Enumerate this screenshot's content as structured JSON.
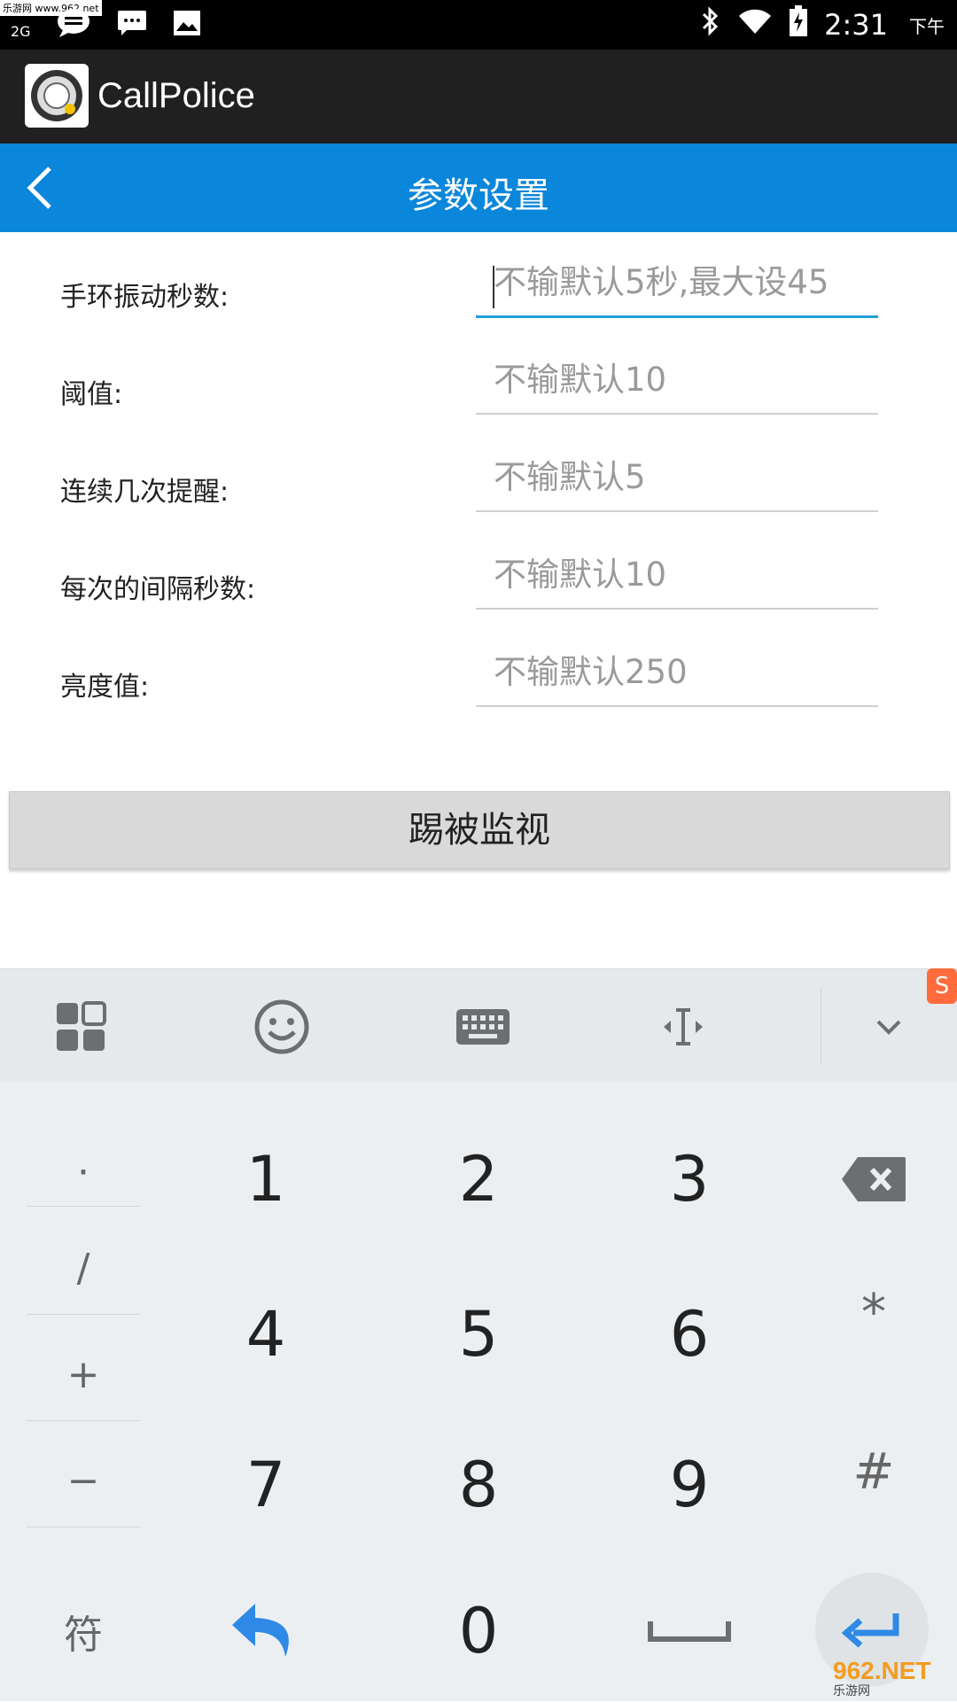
{
  "status_bar": {
    "watermark": "乐游网 www.962.net",
    "network": "2G",
    "time": "2:31",
    "ampm": "下午"
  },
  "app_bar": {
    "title": "CallPolice"
  },
  "nav": {
    "title": "参数设置"
  },
  "form": {
    "rows": [
      {
        "label": "手环振动秒数:",
        "placeholder": "不输默认5秒,最大设45"
      },
      {
        "label": "阈值:",
        "placeholder": "不输默认10"
      },
      {
        "label": "连续几次提醒:",
        "placeholder": "不输默认5"
      },
      {
        "label": "每次的间隔秒数:",
        "placeholder": "不输默认10"
      },
      {
        "label": "亮度值:",
        "placeholder": "不输默认250"
      }
    ]
  },
  "action_button": {
    "label": "踢被监视"
  },
  "keyboard": {
    "side_keys": [
      "·",
      "/",
      "+",
      "−"
    ],
    "digits": [
      "1",
      "2",
      "3",
      "4",
      "5",
      "6",
      "7",
      "8",
      "9",
      "0"
    ],
    "right_keys": [
      "*",
      "#"
    ],
    "symbol_key": "符"
  },
  "watermark_br": {
    "brand": "962.NET",
    "sub": "乐游网"
  },
  "colors": {
    "nav": "#0a86db",
    "app_bar": "#202020",
    "accent": "#1f9fe0"
  }
}
